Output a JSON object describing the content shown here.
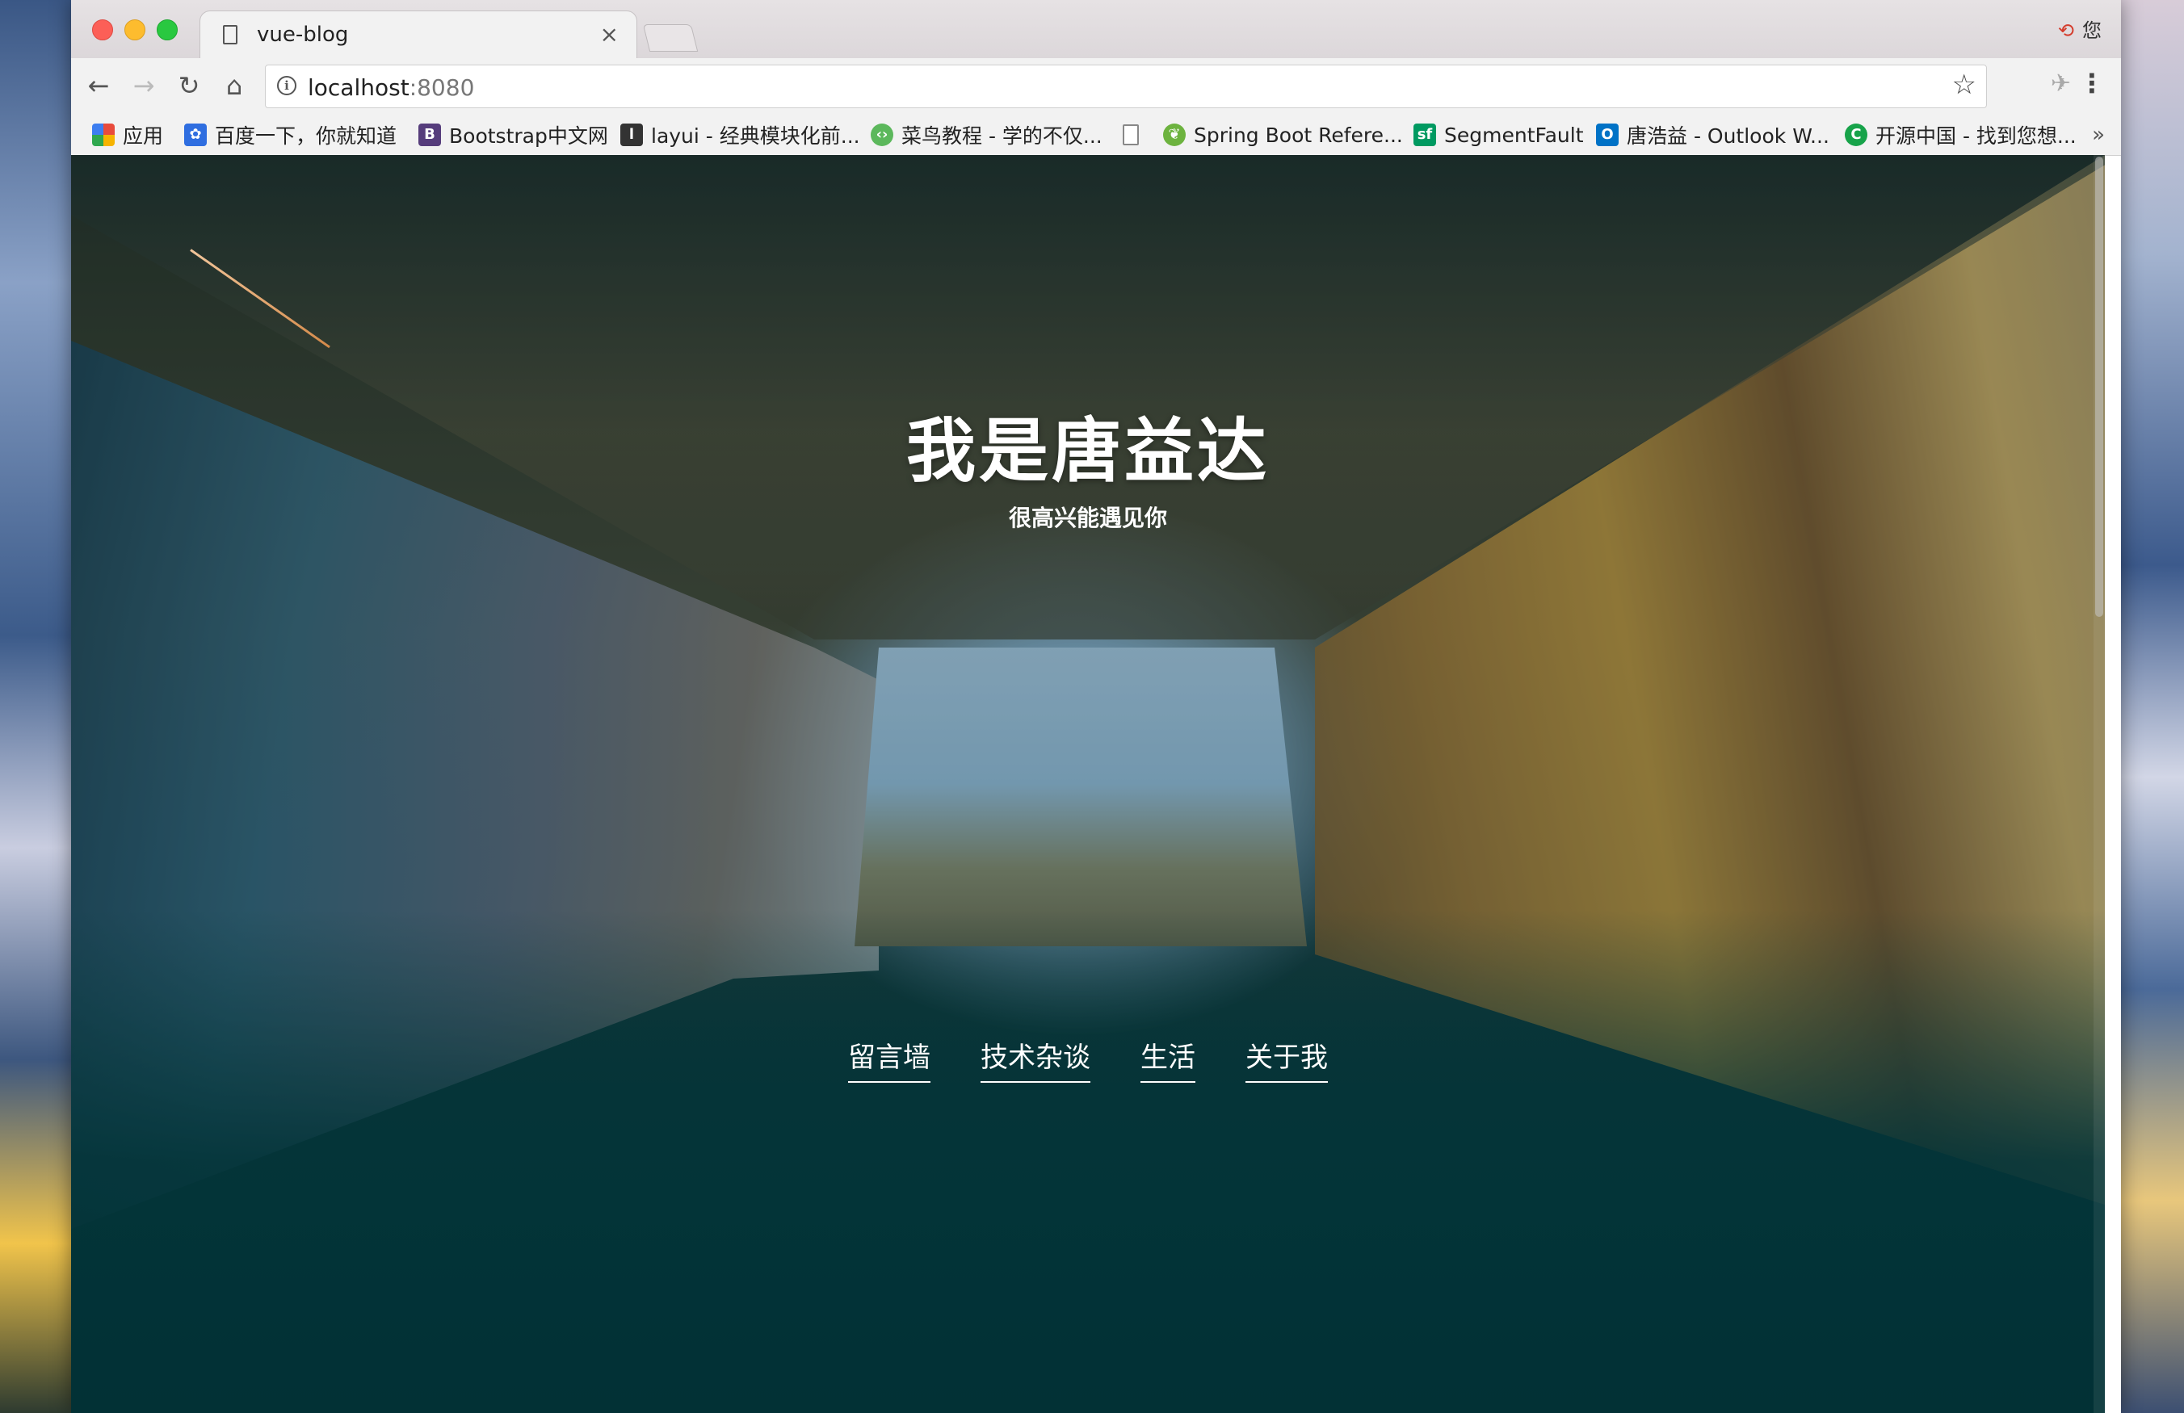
{
  "browser": {
    "tab_title": "vue-blog",
    "tab_close": "×",
    "extension_badge": "您",
    "url_host": "localhost",
    "url_port": ":8080",
    "icons": {
      "back": "back-arrow-icon",
      "forward": "forward-arrow-icon",
      "reload": "reload-icon",
      "home": "home-icon",
      "info": "info-icon",
      "star": "star-icon",
      "menu": "menu-icon"
    }
  },
  "bookmarks": [
    {
      "label": "应用",
      "icon": "apps-grid-icon",
      "color": "#e84b3c"
    },
    {
      "label": "百度一下，你就知道",
      "icon": "baidu-paw-icon",
      "color": "#2f6ee0"
    },
    {
      "label": "Bootstrap中文网",
      "icon": "bootstrap-icon",
      "color": "#563d7c"
    },
    {
      "label": "layui - 经典模块化前...",
      "icon": "layui-icon",
      "color": "#333333"
    },
    {
      "label": "菜鸟教程 - 学的不仅...",
      "icon": "runoob-icon",
      "color": "#5cb85c"
    },
    {
      "label": "",
      "icon": "blank-page-icon",
      "color": "#999999"
    },
    {
      "label": "Spring Boot Refere...",
      "icon": "spring-icon",
      "color": "#6db33f"
    },
    {
      "label": "SegmentFault",
      "icon": "segmentfault-icon",
      "color": "#009a61"
    },
    {
      "label": "唐浩益 - Outlook W...",
      "icon": "outlook-icon",
      "color": "#0072c6"
    },
    {
      "label": "开源中国 - 找到您想...",
      "icon": "oschina-icon",
      "color": "#17a34a"
    }
  ],
  "bookmarks_more": "»",
  "hero": {
    "title": "我是唐益达",
    "subtitle": "很高兴能遇见你",
    "nav": [
      "留言墙",
      "技术杂谈",
      "生活",
      "关于我"
    ]
  }
}
